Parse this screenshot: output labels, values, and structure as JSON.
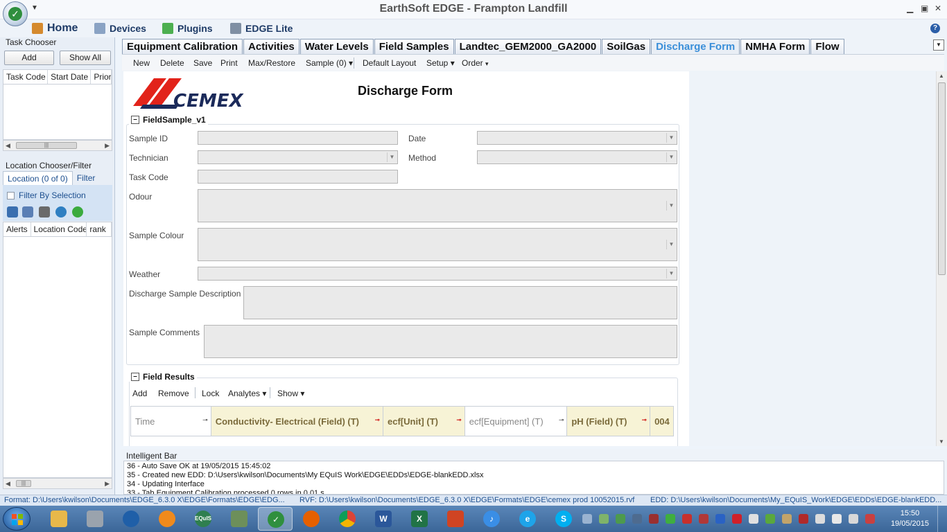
{
  "window": {
    "title": "EarthSoft EDGE - Frampton Landfill"
  },
  "menu": {
    "home": "Home",
    "devices": "Devices",
    "plugins": "Plugins",
    "edge_lite": "EDGE Lite"
  },
  "task_chooser": {
    "title": "Task Chooser",
    "add": "Add",
    "show_all": "Show All",
    "columns": [
      "Task Code",
      "Start Date",
      "Priori"
    ]
  },
  "location_chooser": {
    "title": "Location Chooser/Filter",
    "tabs": [
      "Location (0 of 0)",
      "Filter"
    ],
    "filter_by_selection": "Filter By Selection",
    "columns": [
      "Alerts",
      "Location Code",
      "rank"
    ]
  },
  "tabs": [
    "Equipment Calibration",
    "Activities",
    "Water Levels",
    "Field Samples",
    "Landtec_GEM2000_GA2000",
    "SoilGas",
    "Discharge Form",
    "NMHA Form",
    "Flow"
  ],
  "active_tab": "Discharge Form",
  "toolbar": {
    "new": "New",
    "delete": "Delete",
    "save": "Save",
    "print": "Print",
    "max_restore": "Max/Restore",
    "sample": "Sample (0)",
    "default_layout": "Default Layout",
    "setup": "Setup",
    "order": "Order"
  },
  "form": {
    "logo_text": "CEMEX",
    "title": "Discharge Form",
    "section1": "FieldSample_v1",
    "labels": {
      "sample_id": "Sample ID",
      "date": "Date",
      "technician": "Technician",
      "method": "Method",
      "task_code": "Task Code",
      "odour": "Odour",
      "sample_colour": "Sample Colour",
      "weather": "Weather",
      "discharge_desc": "Discharge Sample Description",
      "sample_comments": "Sample Comments"
    },
    "section2": "Field Results",
    "results_toolbar": {
      "add": "Add",
      "remove": "Remove",
      "lock": "Lock",
      "analytes": "Analytes",
      "show": "Show"
    },
    "results_columns": [
      "Time",
      "Conductivity- Electrical (Field) (T)",
      "ecf[Unit] (T)",
      "ecf[Equipment] (T)",
      "pH (Field) (T)",
      "004"
    ]
  },
  "intelligent_bar": {
    "title": "Intelligent Bar",
    "lines": [
      "36 - Auto Save OK at 19/05/2015 15:45:02",
      "35 - Created new EDD: D:\\Users\\kwilson\\Documents\\My EQuIS Work\\EDGE\\EDDs\\EDGE-blankEDD.xlsx",
      "34 - Updating Interface",
      "33 - Tab Equipment Calibration processed 0 rows in 0.01 s"
    ]
  },
  "status": {
    "format": "Format:  D:\\Users\\kwilson\\Documents\\EDGE_6.3.0 X\\EDGE\\Formats\\EDGE\\EDG...",
    "rvf": "RVF:  D:\\Users\\kwilson\\Documents\\EDGE_6.3.0 X\\EDGE\\Formats\\EDGE\\cemex prod 10052015.rvf",
    "edd": "EDD:  D:\\Users\\kwilson\\Documents\\My_EQuIS_Work\\EDGE\\EDDs\\EDGE-blankEDD..."
  },
  "clock": {
    "time": "15:50",
    "date": "19/05/2015"
  },
  "colors": {
    "accent": "#3b8fd9",
    "required_header": "#f7f3d6",
    "logo_red": "#e2231a",
    "logo_navy": "#1b2a5a"
  }
}
